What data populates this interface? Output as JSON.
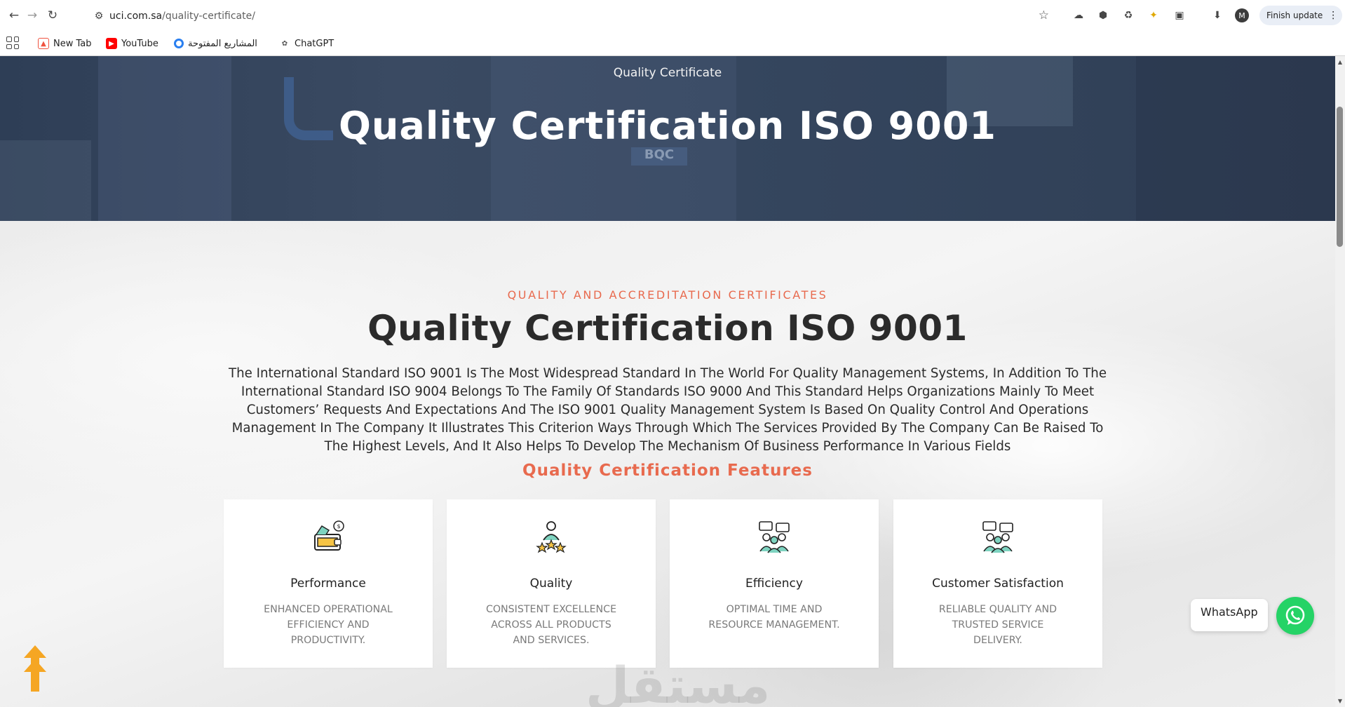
{
  "browser": {
    "url_host": "uci.com.sa",
    "url_path": "/quality-certificate/",
    "finish_update_label": "Finish update",
    "avatar_initial": "M",
    "bookmarks": [
      {
        "label": "New Tab",
        "icon": "laravel-icon",
        "color": "#f05340"
      },
      {
        "label": "YouTube",
        "icon": "youtube-icon",
        "color": "#ff0000"
      },
      {
        "label": "المشاريع المفتوحة",
        "icon": "globe-icon",
        "color": "#2a7ff0"
      },
      {
        "label": "ChatGPT",
        "icon": "chatgpt-icon",
        "color": "#555555"
      }
    ]
  },
  "hero": {
    "subtitle": "Quality Certificate",
    "title": "Quality Certification ISO 9001"
  },
  "section": {
    "kicker": "QUALITY AND ACCREDITATION CERTIFICATES",
    "title": "Quality Certification ISO 9001",
    "description": "The International Standard ISO 9001 Is The Most Widespread Standard In The World For Quality Management Systems, In Addition To The International Standard ISO 9004 Belongs To The Family Of Standards ISO 9000 And This Standard Helps Organizations Mainly To Meet Customers’ Requests And Expectations And The ISO 9001 Quality Management System Is Based On Quality Control And Operations Management In The Company It Illustrates This Criterion Ways Through Which The Services Provided By The Company Can Be Raised To The Highest Levels, And It Also Helps To Develop The Mechanism Of Business Performance In Various Fields",
    "features_title": "Quality Certification Features"
  },
  "features": [
    {
      "title": "Performance",
      "text": "Enhanced operational efficiency and productivity.",
      "icon": "wallet-money-icon"
    },
    {
      "title": "Quality",
      "text": "Consistent excellence across all products and services.",
      "icon": "person-stars-icon"
    },
    {
      "title": "Efficiency",
      "text": "Optimal time and resource management.",
      "icon": "team-chat-icon"
    },
    {
      "title": "Customer Satisfaction",
      "text": "Reliable quality and trusted service delivery.",
      "icon": "team-chat-icon"
    }
  ],
  "whatsapp": {
    "label": "WhatsApp",
    "color": "#25d366"
  },
  "colors": {
    "accent": "#e86a4e",
    "hero_bg": "#34455d",
    "scroll_top": "#f5a623"
  }
}
